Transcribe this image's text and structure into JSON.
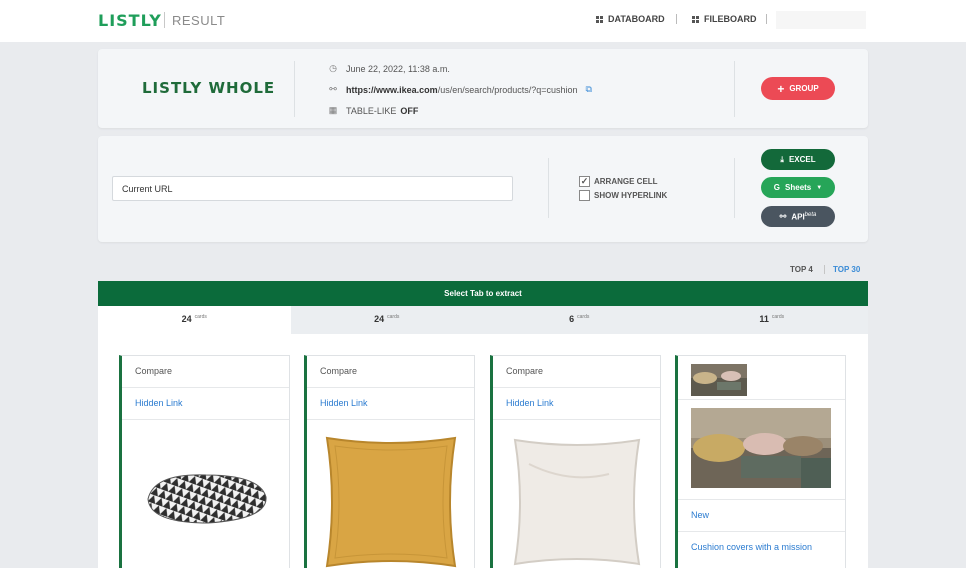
{
  "header": {
    "brand": "LISTLY",
    "subtitle": "RESULT",
    "nav": [
      {
        "label": "DATABOARD",
        "icon": "grid-icon"
      },
      {
        "label": "FILEBOARD",
        "icon": "grid-icon"
      }
    ]
  },
  "summary": {
    "title": "LISTLY WHOLE",
    "date": "June 22, 2022, 11:38 a.m.",
    "url_bold": "https://www.ikea.com",
    "url_rest": "/us/en/search/products/?q=cushion",
    "table_like_label": "TABLE-LIKE",
    "table_like_value": "OFF",
    "group_button": "GROUP"
  },
  "export": {
    "url_field_value": "Current URL",
    "arrange_cell_label": "ARRANGE CELL",
    "arrange_cell_checked": true,
    "show_hyperlink_label": "SHOW HYPERLINK",
    "show_hyperlink_checked": false,
    "excel_button": "EXCEL",
    "sheets_button": "Sheets",
    "api_button": "API",
    "api_badge": "beta"
  },
  "top_links": {
    "top4": "TOP 4",
    "top30": "TOP 30"
  },
  "tab_bar_label": "Select Tab to extract",
  "tabs": [
    {
      "count": "24",
      "unit": "cards",
      "active": true
    },
    {
      "count": "24",
      "unit": "cards",
      "active": false
    },
    {
      "count": "6",
      "unit": "cards",
      "active": false
    },
    {
      "count": "11",
      "unit": "cards",
      "active": false
    }
  ],
  "cards": [
    {
      "row1": "Compare",
      "row2": "Hidden Link",
      "image": "patterned-cushion"
    },
    {
      "row1": "Compare",
      "row2": "Hidden Link",
      "image": "yellow-cushion"
    },
    {
      "row1": "Compare",
      "row2": "Hidden Link",
      "image": "white-cushion"
    },
    {
      "row1": "New",
      "row2": "Cushion covers with a mission",
      "image": "bedroom-photo"
    }
  ],
  "colors": {
    "brand_green": "#1f9e5a",
    "dark_green": "#0b6b3b",
    "group_red": "#ec4a55",
    "link_blue": "#2a7bd0"
  }
}
